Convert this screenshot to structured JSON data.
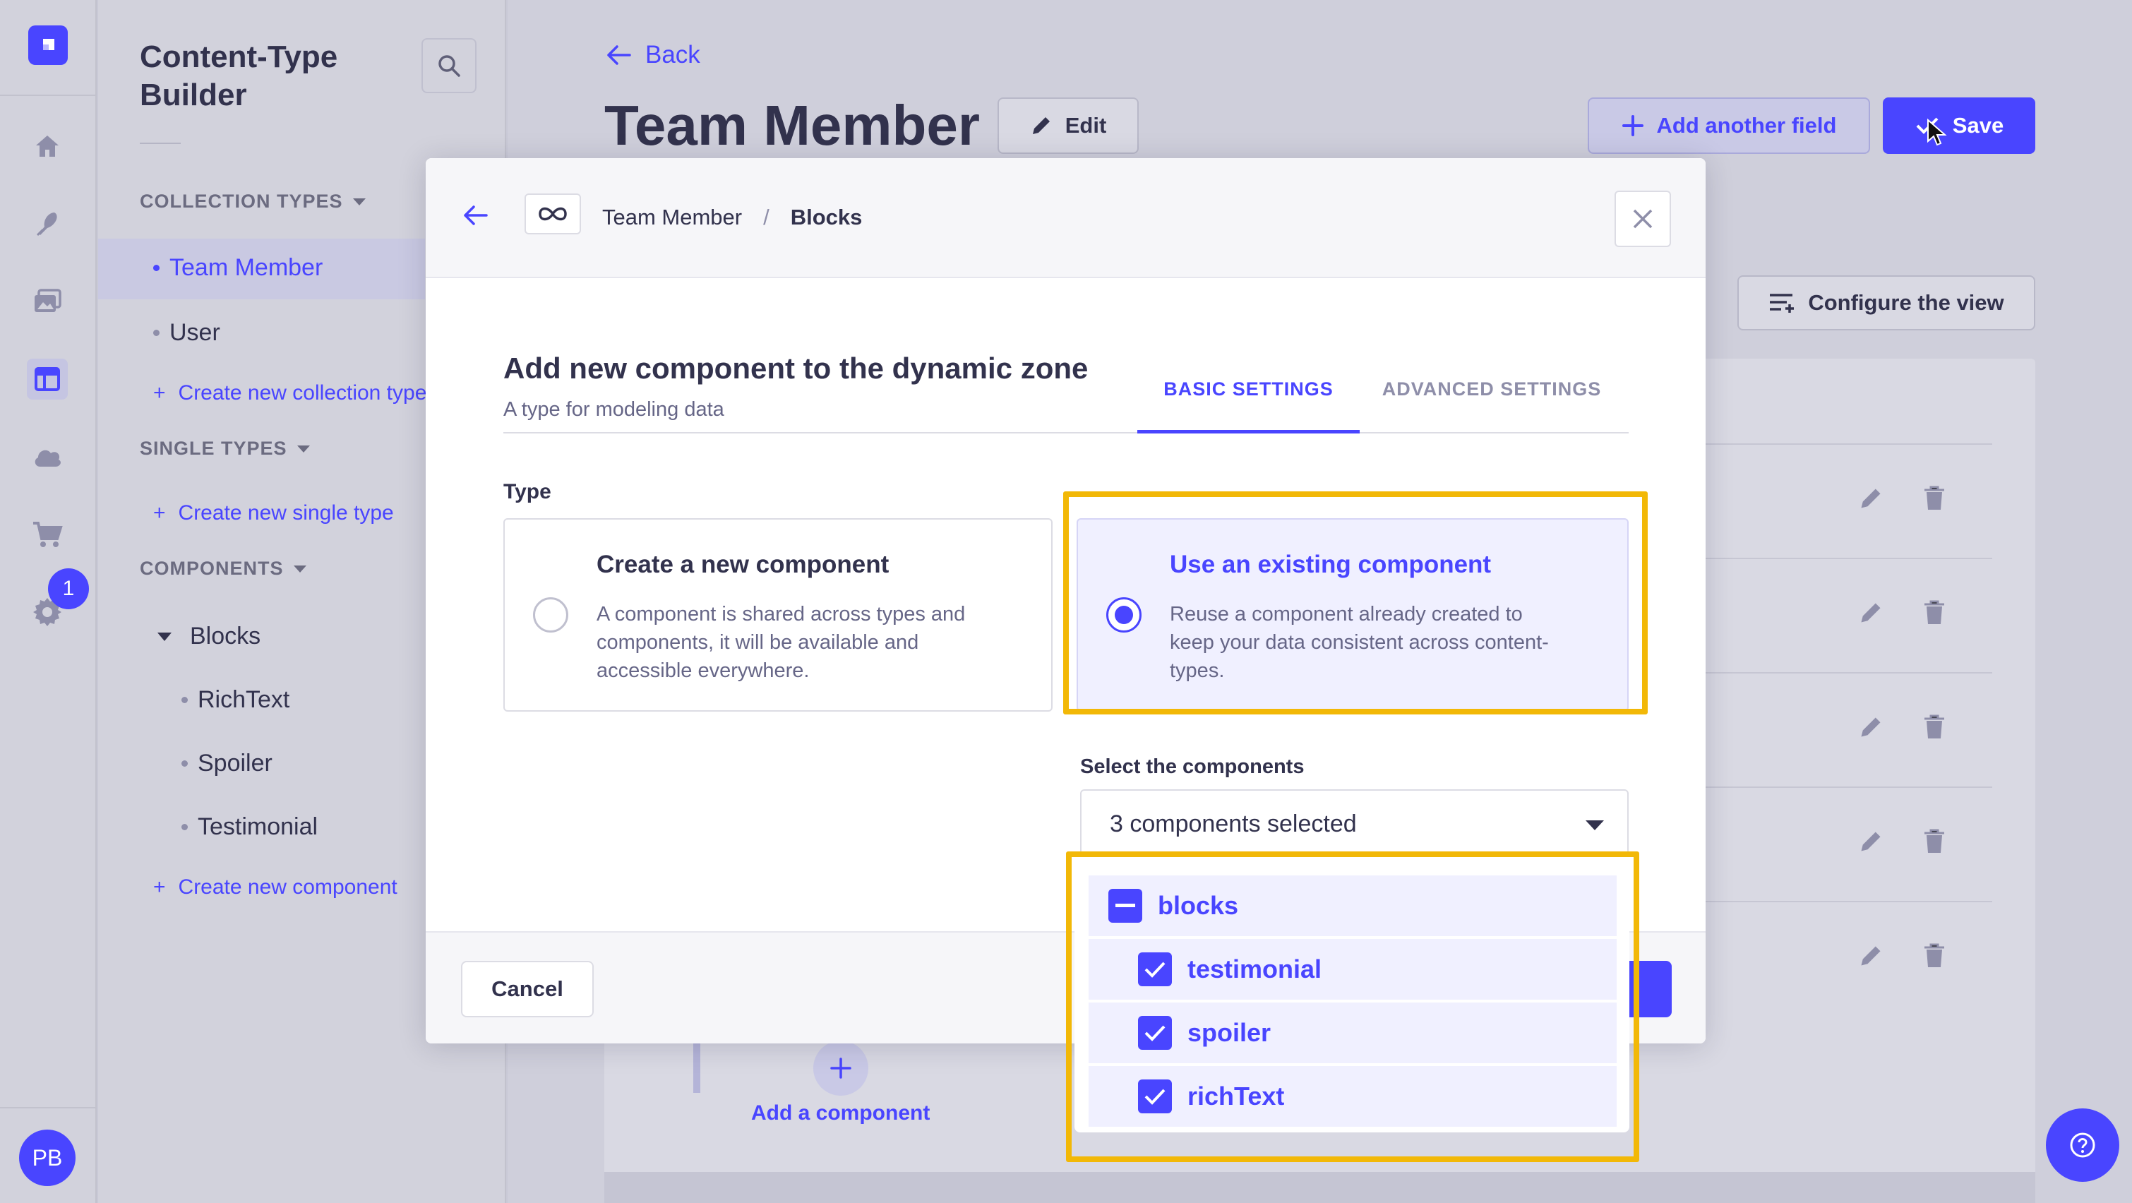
{
  "sidebar": {
    "title_line1": "Content-Type",
    "title_line2": "Builder",
    "collection_types_label": "COLLECTION TYPES",
    "collection_items": [
      "Team Member",
      "User"
    ],
    "create_collection_label": "Create new collection type",
    "single_types_label": "SINGLE TYPES",
    "create_single_label": "Create new single type",
    "components_label": "COMPONENTS",
    "component_group": "Blocks",
    "component_items": [
      "RichText",
      "Spoiler",
      "Testimonial"
    ],
    "create_component_label": "Create new component"
  },
  "rail": {
    "notification_count": "1",
    "avatar_initials": "PB"
  },
  "header": {
    "back_label": "Back",
    "page_title": "Team Member",
    "edit_label": "Edit",
    "add_field_label": "Add another field",
    "save_label": "Save",
    "configure_view_label": "Configure the view"
  },
  "background": {
    "add_component_label": "Add a component"
  },
  "modal": {
    "breadcrumb_parent": "Team Member",
    "breadcrumb_separator": "/",
    "breadcrumb_current": "Blocks",
    "title": "Add new component to the dynamic zone",
    "subtitle": "A type for modeling data",
    "tab_basic": "BASIC SETTINGS",
    "tab_advanced": "ADVANCED SETTINGS",
    "type_label": "Type",
    "option_new_title": "Create a new component",
    "option_new_desc": [
      "A component is shared across types and",
      "components, it will be available and",
      "accessible everywhere."
    ],
    "option_existing_title": "Use an existing component",
    "option_existing_desc": [
      "Reuse a component already created to",
      "keep your data consistent across content-",
      "types."
    ],
    "select_label": "Select the components",
    "select_value": "3 components selected",
    "cancel_label": "Cancel"
  },
  "dropdown": {
    "group": "blocks",
    "options": [
      "testimonial",
      "spoiler",
      "richText"
    ]
  },
  "colors": {
    "primary": "#4945ff",
    "highlight": "#f2b807",
    "text": "#32324d"
  }
}
